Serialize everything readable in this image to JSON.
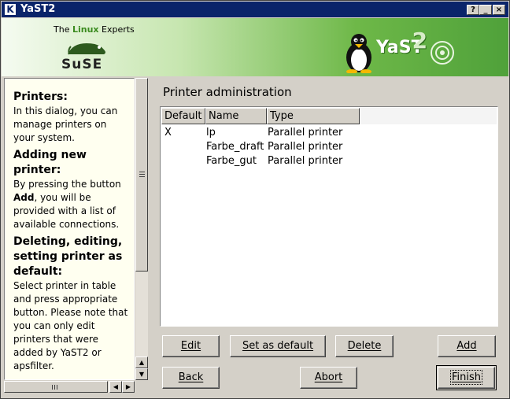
{
  "window": {
    "title": "YaST2",
    "controls": [
      "?",
      "_",
      "□",
      "×"
    ]
  },
  "banner": {
    "tagline_prefix": "The ",
    "tagline_highlight": "Linux",
    "tagline_suffix": " Experts",
    "brand": "SuSE",
    "product": "YaST",
    "product_num": "2"
  },
  "help": {
    "sections": [
      {
        "heading": "Printers:",
        "text": "In this dialog, you can manage printers on your system."
      },
      {
        "heading": "Adding new printer:",
        "text_before": "By pressing the button ",
        "text_bold": "Add",
        "text_after": ", you will be provided with a list of available connections."
      },
      {
        "heading": "Deleting, editing, setting printer as default:",
        "text": "Select printer in table and press appropriate button. Please note that you can only edit printers that were added by YaST2 or apsfilter."
      }
    ]
  },
  "main": {
    "title": "Printer administration",
    "columns": [
      "Default",
      "Name",
      "Type"
    ],
    "rows": [
      {
        "default": "X",
        "name": "lp",
        "type": "Parallel printer"
      },
      {
        "default": "",
        "name": "Farbe_draft",
        "type": "Parallel printer"
      },
      {
        "default": "",
        "name": "Farbe_gut",
        "type": "Parallel printer"
      }
    ]
  },
  "buttons": {
    "edit": "Edit",
    "set_default": "Set as default",
    "delete": "Delete",
    "add": "Add",
    "back": "Back",
    "abort": "Abort",
    "finish": "Finish"
  },
  "colors": {
    "titlebar": "#0a246a",
    "banner_green": "#4fa13a",
    "help_bg": "#fffff0"
  }
}
